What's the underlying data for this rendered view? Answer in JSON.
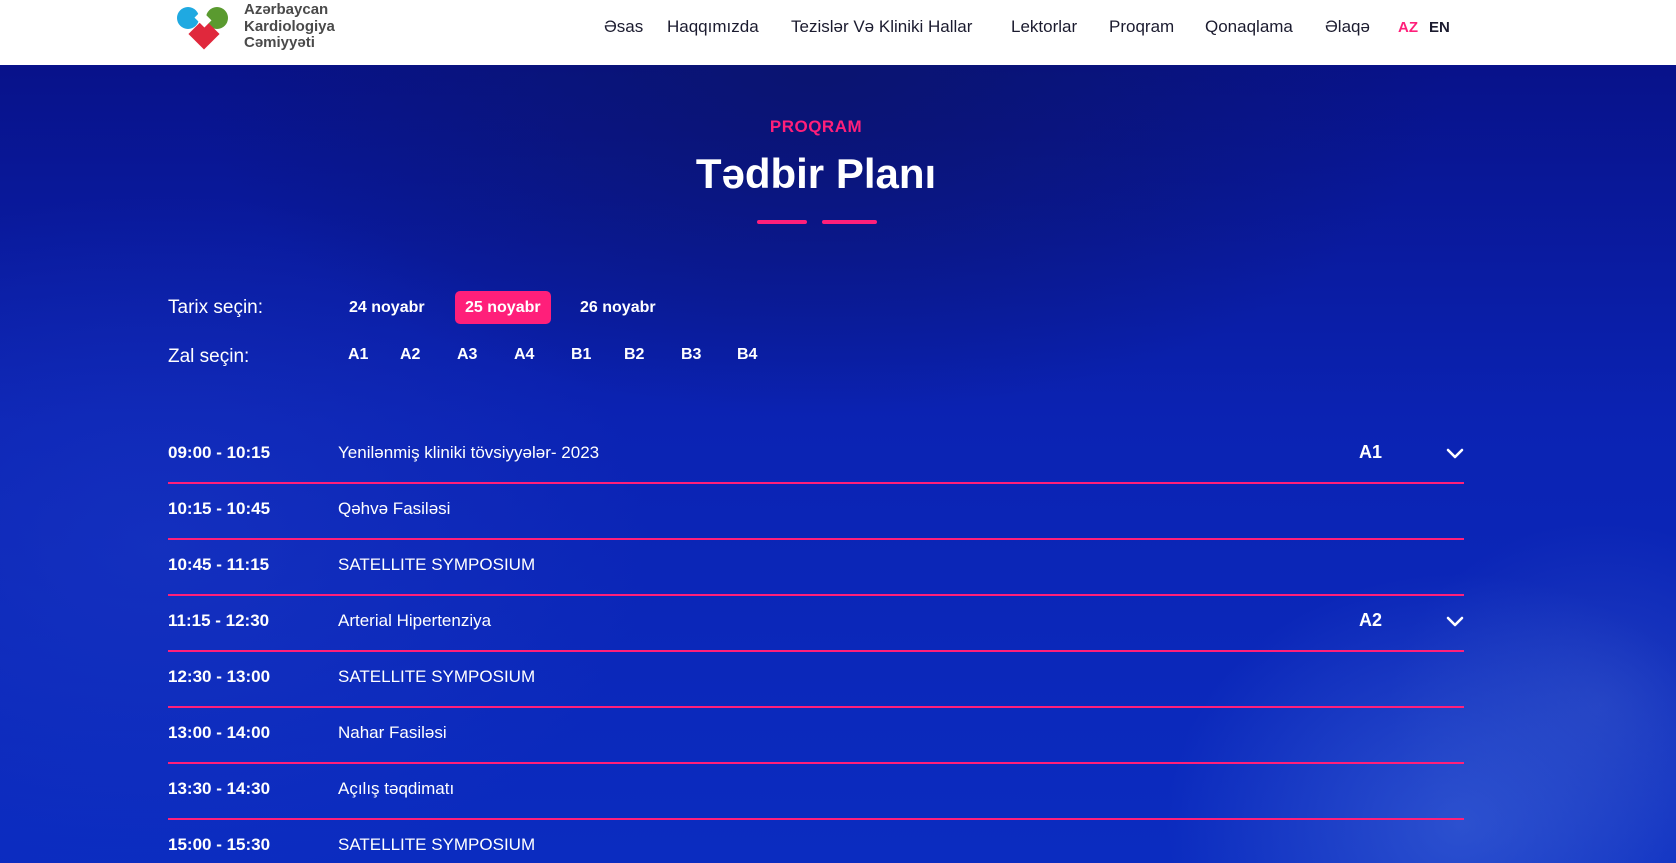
{
  "brand": {
    "logo_lines": [
      "Azərbaycan",
      "Kardiologiya",
      "Cəmiyyəti"
    ],
    "colors": {
      "cyan": "#1fa9e1",
      "green": "#5a9a2f",
      "red": "#e0283c",
      "accent": "#ff1f7a"
    }
  },
  "nav": {
    "items": [
      "Əsas",
      "Haqqımızda",
      "Tezislər Və Kliniki Hallar",
      "Lektorlar",
      "Proqram",
      "Qonaqlama",
      "Əlaqə"
    ],
    "languages": [
      "AZ",
      "EN"
    ],
    "active_language": "AZ"
  },
  "hero": {
    "eyebrow": "PROQRAM",
    "title": "Tədbir Planı"
  },
  "filters": {
    "date_label": "Tarix seçin:",
    "dates": [
      "24 noyabr",
      "25 noyabr",
      "26 noyabr"
    ],
    "selected_date": "25 noyabr",
    "hall_label": "Zal seçin:",
    "halls": [
      "A1",
      "A2",
      "A3",
      "A4",
      "B1",
      "B2",
      "B3",
      "B4"
    ]
  },
  "schedule": [
    {
      "time": "09:00 - 10:15",
      "title": "Yenilənmiş kliniki tövsiyyələr- 2023",
      "hall": "A1",
      "expandable": true
    },
    {
      "time": "10:15 - 10:45",
      "title": "Qəhvə Fasiləsi",
      "hall": "",
      "expandable": false
    },
    {
      "time": "10:45 - 11:15",
      "title": "SATELLITE SYMPOSIUM",
      "hall": "",
      "expandable": false
    },
    {
      "time": "11:15 - 12:30",
      "title": "Arterial Hipertenziya",
      "hall": "A2",
      "expandable": true
    },
    {
      "time": "12:30 - 13:00",
      "title": "SATELLITE SYMPOSIUM",
      "hall": "",
      "expandable": false
    },
    {
      "time": "13:00 - 14:00",
      "title": "Nahar Fasiləsi",
      "hall": "",
      "expandable": false
    },
    {
      "time": "13:30 - 14:30",
      "title": "Açılış təqdimatı",
      "hall": "",
      "expandable": false
    },
    {
      "time": "15:00 - 15:30",
      "title": "SATELLITE SYMPOSIUM",
      "hall": "",
      "expandable": false
    }
  ],
  "icons": {
    "expand": "chevron-down-icon"
  }
}
